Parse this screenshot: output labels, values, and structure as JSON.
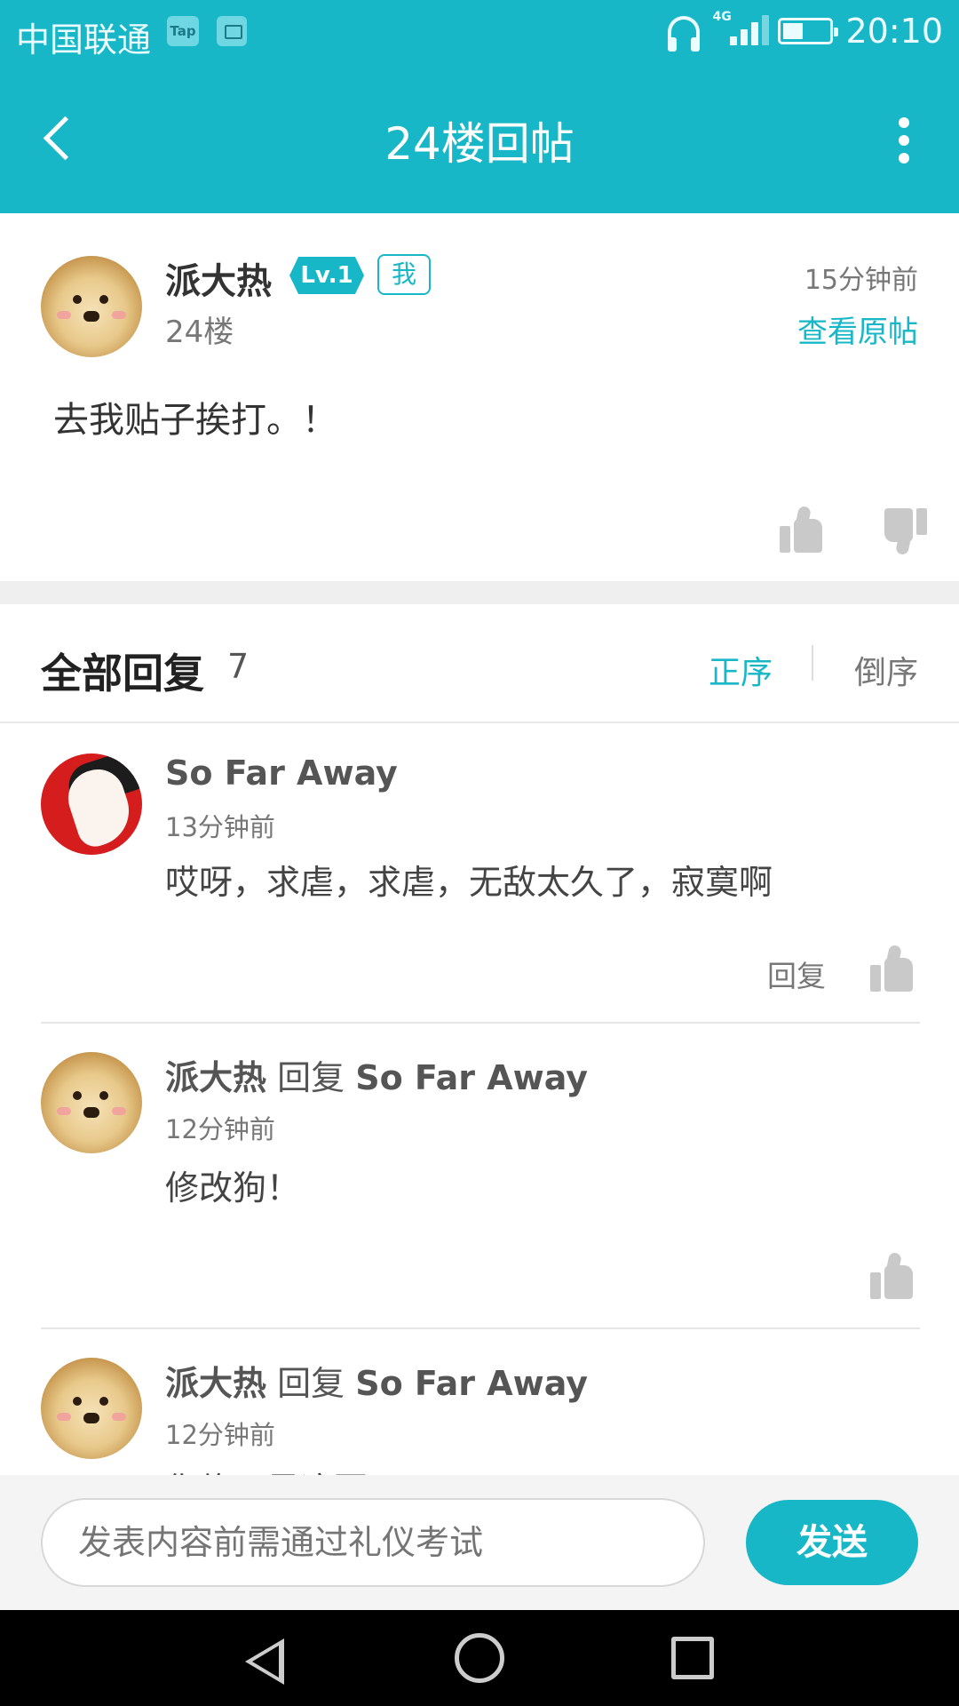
{
  "status_bar": {
    "carrier": "中国联通",
    "tap_badge": "Tap",
    "network": "4G",
    "time": "20:10",
    "battery_level": 0.4
  },
  "app_bar": {
    "title": "24楼回帖"
  },
  "post": {
    "author": "派大热",
    "level": "Lv.1",
    "me_badge": "我",
    "floor": "24楼",
    "time": "15分钟前",
    "view_original": "查看原帖",
    "content": "去我贴子挨打。！"
  },
  "replies_header": {
    "title": "全部回复",
    "count": "7",
    "sort_asc": "正序",
    "sort_desc": "倒序"
  },
  "replies": [
    {
      "author": "So Far Away",
      "reply_word": "",
      "reply_to": "",
      "time": "13分钟前",
      "content": "哎呀，求虐，求虐，无敌太久了，寂寞啊",
      "reply_label": "回复"
    },
    {
      "author": "派大热",
      "reply_word": "回复",
      "reply_to": "So Far Away",
      "time": "12分钟前",
      "content": "修改狗！"
    },
    {
      "author": "派大热",
      "reply_word": "回复",
      "reply_to": "So Far Away",
      "time": "12分钟前",
      "content": "你修正是这要"
    }
  ],
  "composer": {
    "placeholder": "发表内容前需通过礼仪考试",
    "send_label": "发送"
  },
  "colors": {
    "accent": "#18b7c7",
    "background": "#ffffff",
    "divider": "#efefef"
  }
}
